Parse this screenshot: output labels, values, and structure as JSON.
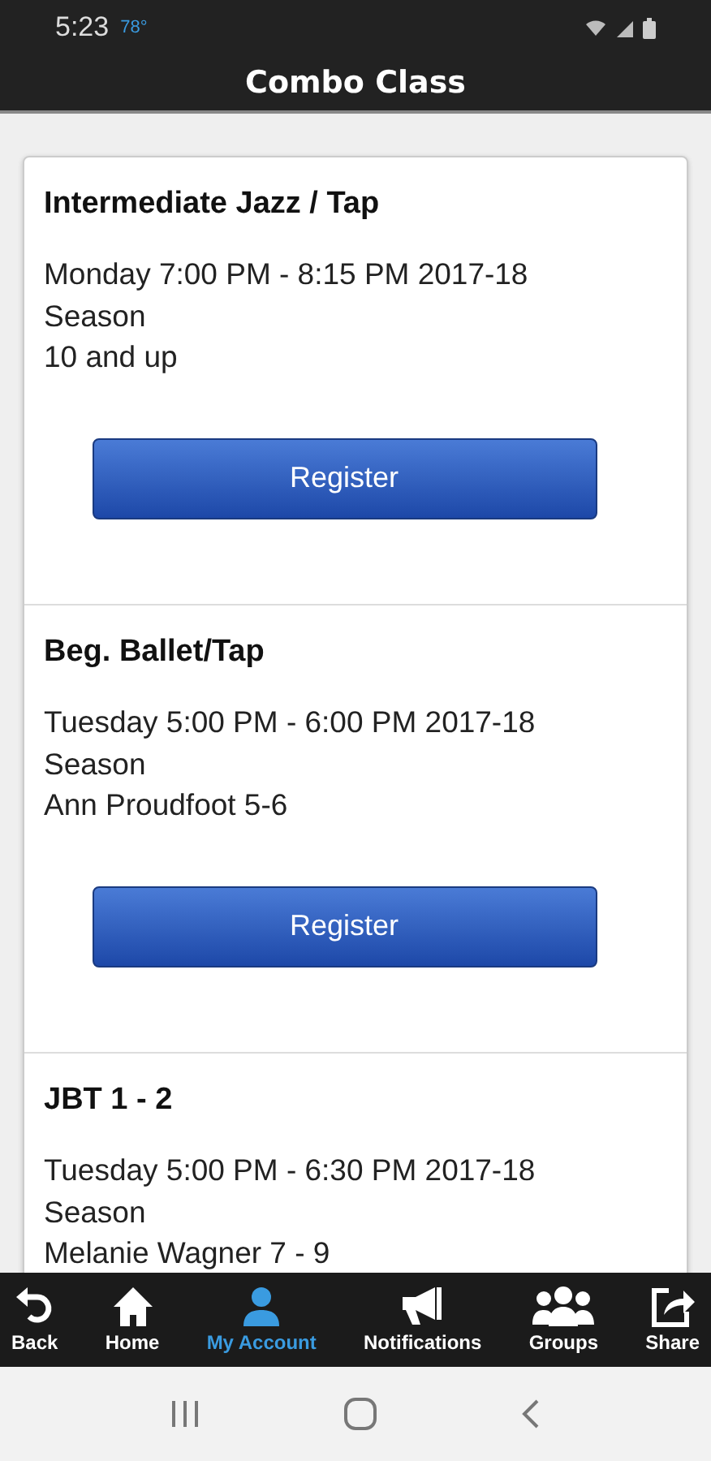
{
  "status_bar": {
    "time": "5:23",
    "temperature": "78°"
  },
  "header": {
    "title": "Combo Class"
  },
  "classes": [
    {
      "name": "Intermediate Jazz / Tap",
      "schedule": "Monday 7:00 PM - 8:15 PM 2017-18 Season",
      "detail": "10 and up",
      "button": "Register"
    },
    {
      "name": "Beg. Ballet/Tap",
      "schedule": "Tuesday 5:00 PM - 6:00 PM 2017-18 Season",
      "detail": "Ann Proudfoot 5-6",
      "button": "Register"
    },
    {
      "name": "JBT 1 - 2",
      "schedule": "Tuesday 5:00 PM - 6:30 PM 2017-18 Season",
      "detail": "Melanie Wagner 7 - 9"
    }
  ],
  "tab_bar": [
    {
      "kind": "back",
      "label": "Back",
      "selected": false
    },
    {
      "kind": "home",
      "label": "Home",
      "selected": false
    },
    {
      "kind": "account",
      "label": "My Account",
      "selected": true
    },
    {
      "kind": "notifications",
      "label": "Notifications",
      "selected": false
    },
    {
      "kind": "groups",
      "label": "Groups",
      "selected": false
    },
    {
      "kind": "share",
      "label": "Share",
      "selected": false
    }
  ]
}
